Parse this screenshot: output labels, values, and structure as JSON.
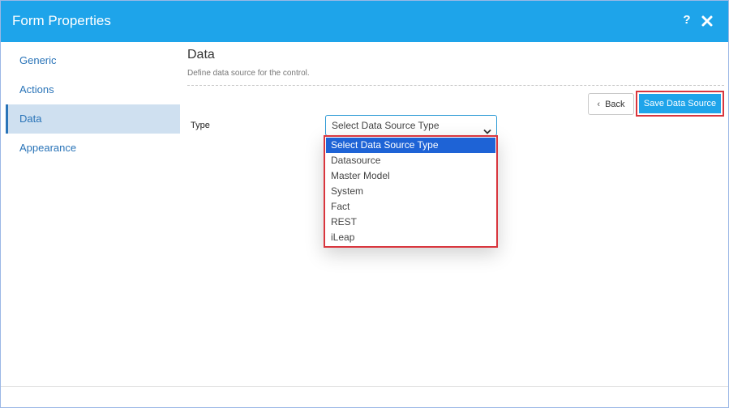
{
  "window": {
    "title": "Form Properties",
    "help_label": "?",
    "close_icon": "close-icon",
    "accent_color": "#1ea4ea"
  },
  "sidebar": {
    "items": [
      {
        "label": "Generic",
        "active": false
      },
      {
        "label": "Actions",
        "active": false
      },
      {
        "label": "Data",
        "active": true
      },
      {
        "label": "Appearance",
        "active": false
      }
    ]
  },
  "section": {
    "title": "Data",
    "description": "Define data source for the control."
  },
  "toolbar": {
    "back_label": "Back",
    "save_label": "Save Data Source"
  },
  "type_field": {
    "label": "Type",
    "selected": "Select Data Source Type",
    "options": [
      "Select Data Source Type",
      "Datasource",
      "Master Model",
      "System",
      "Fact",
      "REST",
      "iLeap"
    ]
  }
}
